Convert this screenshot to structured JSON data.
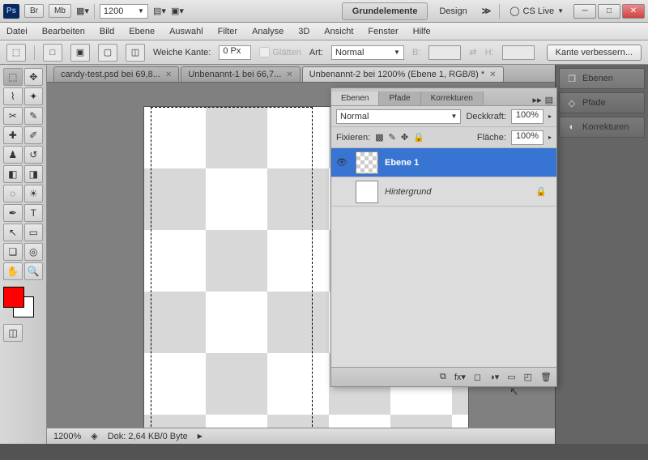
{
  "titlebar": {
    "zoom_value": "1200",
    "workspace_active": "Grundelemente",
    "workspace_other": "Design",
    "cslive": "CS Live"
  },
  "menubar": {
    "items": [
      "Datei",
      "Bearbeiten",
      "Bild",
      "Ebene",
      "Auswahl",
      "Filter",
      "Analyse",
      "3D",
      "Ansicht",
      "Fenster",
      "Hilfe"
    ]
  },
  "optionsbar": {
    "feather_label": "Weiche Kante:",
    "feather_value": "0 Px",
    "antialias": "Glätten",
    "style_label": "Art:",
    "style_value": "Normal",
    "width_label": "B:",
    "height_label": "H:",
    "refine": "Kante verbessern..."
  },
  "tabs": [
    {
      "label": "candy-test.psd bei 69,8...",
      "active": false
    },
    {
      "label": "Unbenannt-1 bei 66,7...",
      "active": false
    },
    {
      "label": "Unbenannt-2 bei 1200% (Ebene 1, RGB/8) *",
      "active": true
    }
  ],
  "statusbar": {
    "zoom": "1200%",
    "doc_info": "Dok: 2,64 KB/0 Byte"
  },
  "right_panel": {
    "items": [
      "Ebenen",
      "Pfade",
      "Korrekturen"
    ]
  },
  "layers_panel": {
    "tabs": [
      "Ebenen",
      "Pfade",
      "Korrekturen"
    ],
    "blend_mode": "Normal",
    "opacity_label": "Deckkraft:",
    "opacity_value": "100%",
    "lock_label": "Fixieren:",
    "fill_label": "Fläche:",
    "fill_value": "100%",
    "layers": [
      {
        "name": "Ebene 1",
        "visible": true,
        "transparent": true,
        "selected": true,
        "locked": false
      },
      {
        "name": "Hintergrund",
        "visible": false,
        "transparent": false,
        "selected": false,
        "locked": true
      }
    ]
  }
}
